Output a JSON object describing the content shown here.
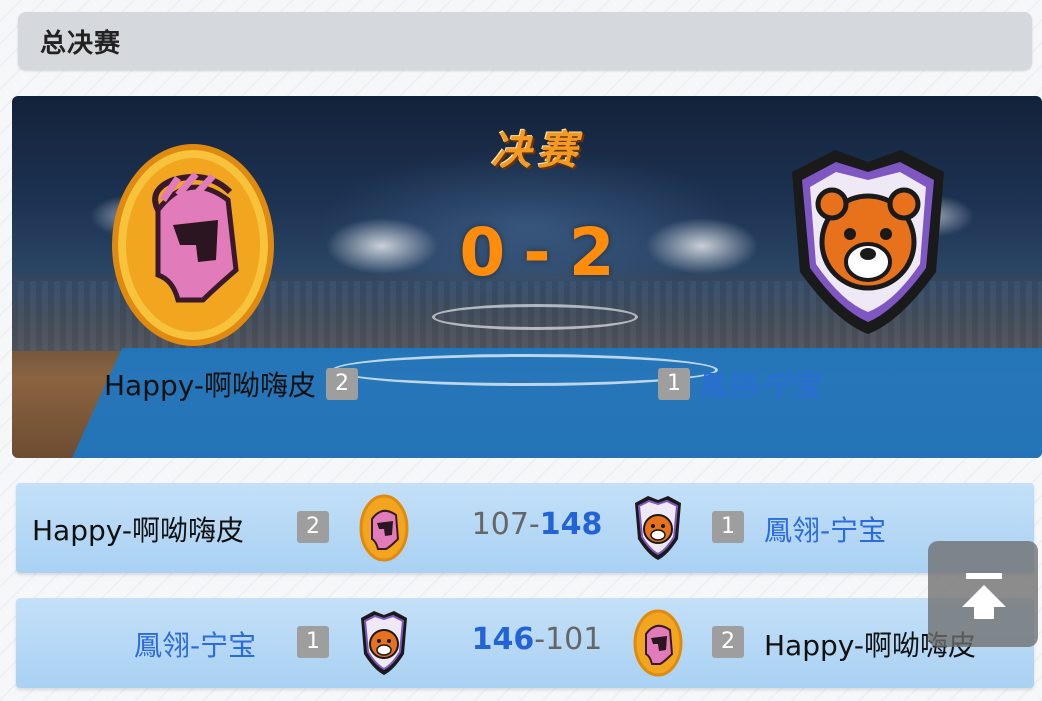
{
  "header": {
    "title": "总决赛"
  },
  "hero": {
    "stage_title": "决赛",
    "score_home": "0",
    "score_sep": "-",
    "score_away": "2",
    "home_team": {
      "name": "Happy-啊呦嗨皮",
      "seed": "2",
      "logo": "spartan-helmet-icon"
    },
    "away_team": {
      "name": "鳳翎-宁宝",
      "seed": "1",
      "logo": "bear-shield-icon"
    }
  },
  "games": [
    {
      "left_team": "Happy-啊呦嗨皮",
      "left_seed": "2",
      "left_score": "107",
      "sep": "-",
      "right_score": "148",
      "right_seed": "1",
      "right_team": "鳳翎-宁宝"
    },
    {
      "left_team": "鳳翎-宁宝",
      "left_seed": "1",
      "left_score": "146",
      "sep": "-",
      "right_score": "101",
      "right_seed": "2",
      "right_team": "Happy-啊呦嗨皮"
    }
  ],
  "colors": {
    "score_orange": "#ff8c0a",
    "winner_blue": "#2463d6",
    "team_blue": "#2c6bdc"
  },
  "scroll_top_icon": "scroll-to-top-icon"
}
